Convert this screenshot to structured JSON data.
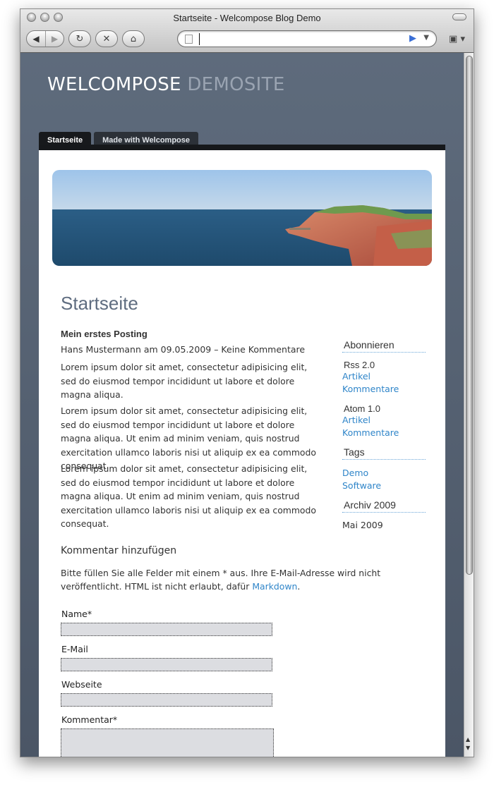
{
  "window": {
    "title": "Startseite - Welcompose Blog Demo",
    "url": ""
  },
  "site": {
    "title_main": "WELCOMPOSE",
    "title_accent": "DEMOSITE"
  },
  "tabs": [
    {
      "label": "Startseite",
      "active": true
    },
    {
      "label": "Made with Welcompose",
      "active": false
    }
  ],
  "page": {
    "heading": "Startseite"
  },
  "post": {
    "title": "Mein erstes Posting",
    "meta": "Hans Mustermann am 09.05.2009 – Keine Kommentare",
    "paragraphs": [
      "Lorem ipsum dolor sit amet, consectetur adipisicing elit, sed do eiusmod tempor incididunt ut labore et dolore magna aliqua.",
      "Lorem ipsum dolor sit amet, consectetur adipisicing elit, sed do eiusmod tempor incididunt ut labore et dolore magna aliqua. Ut enim ad minim veniam, quis nostrud exercitation ullamco laboris nisi ut aliquip ex ea commodo consequat.",
      "Lorem ipsum dolor sit amet, consectetur adipisicing elit, sed do eiusmod tempor incididunt ut labore et dolore magna aliqua. Ut enim ad minim veniam, quis nostrud exercitation ullamco laboris nisi ut aliquip ex ea commodo consequat."
    ]
  },
  "sidebar": {
    "subscribe_heading": "Abonnieren",
    "rss_label": "Rss 2.0",
    "rss_links": [
      "Artikel",
      "Kommentare"
    ],
    "atom_label": "Atom 1.0",
    "atom_links": [
      "Artikel",
      "Kommentare"
    ],
    "tags_heading": "Tags",
    "tags": [
      "Demo",
      "Software"
    ],
    "archive_heading": "Archiv 2009",
    "archive_items": [
      "Mai 2009"
    ]
  },
  "comment_form": {
    "heading": "Kommentar hinzufügen",
    "info_text": "Bitte füllen Sie alle Felder mit einem * aus. Ihre E-Mail-Adresse wird nicht veröffentlicht. HTML ist nicht erlaubt, dafür",
    "info_link": "Markdown",
    "info_end": ".",
    "name_label": "Name*",
    "name_value": "",
    "email_label": "E-Mail",
    "email_value": "",
    "website_label": "Webseite",
    "website_value": "",
    "comment_label": "Kommentar*",
    "comment_value": ""
  },
  "colors": {
    "header_bg": "#5e6b7c",
    "title_accent": "#9aa4b2",
    "heading": "#5f6d80",
    "link": "#2f85c9",
    "field_bg": "#dcdde1"
  }
}
